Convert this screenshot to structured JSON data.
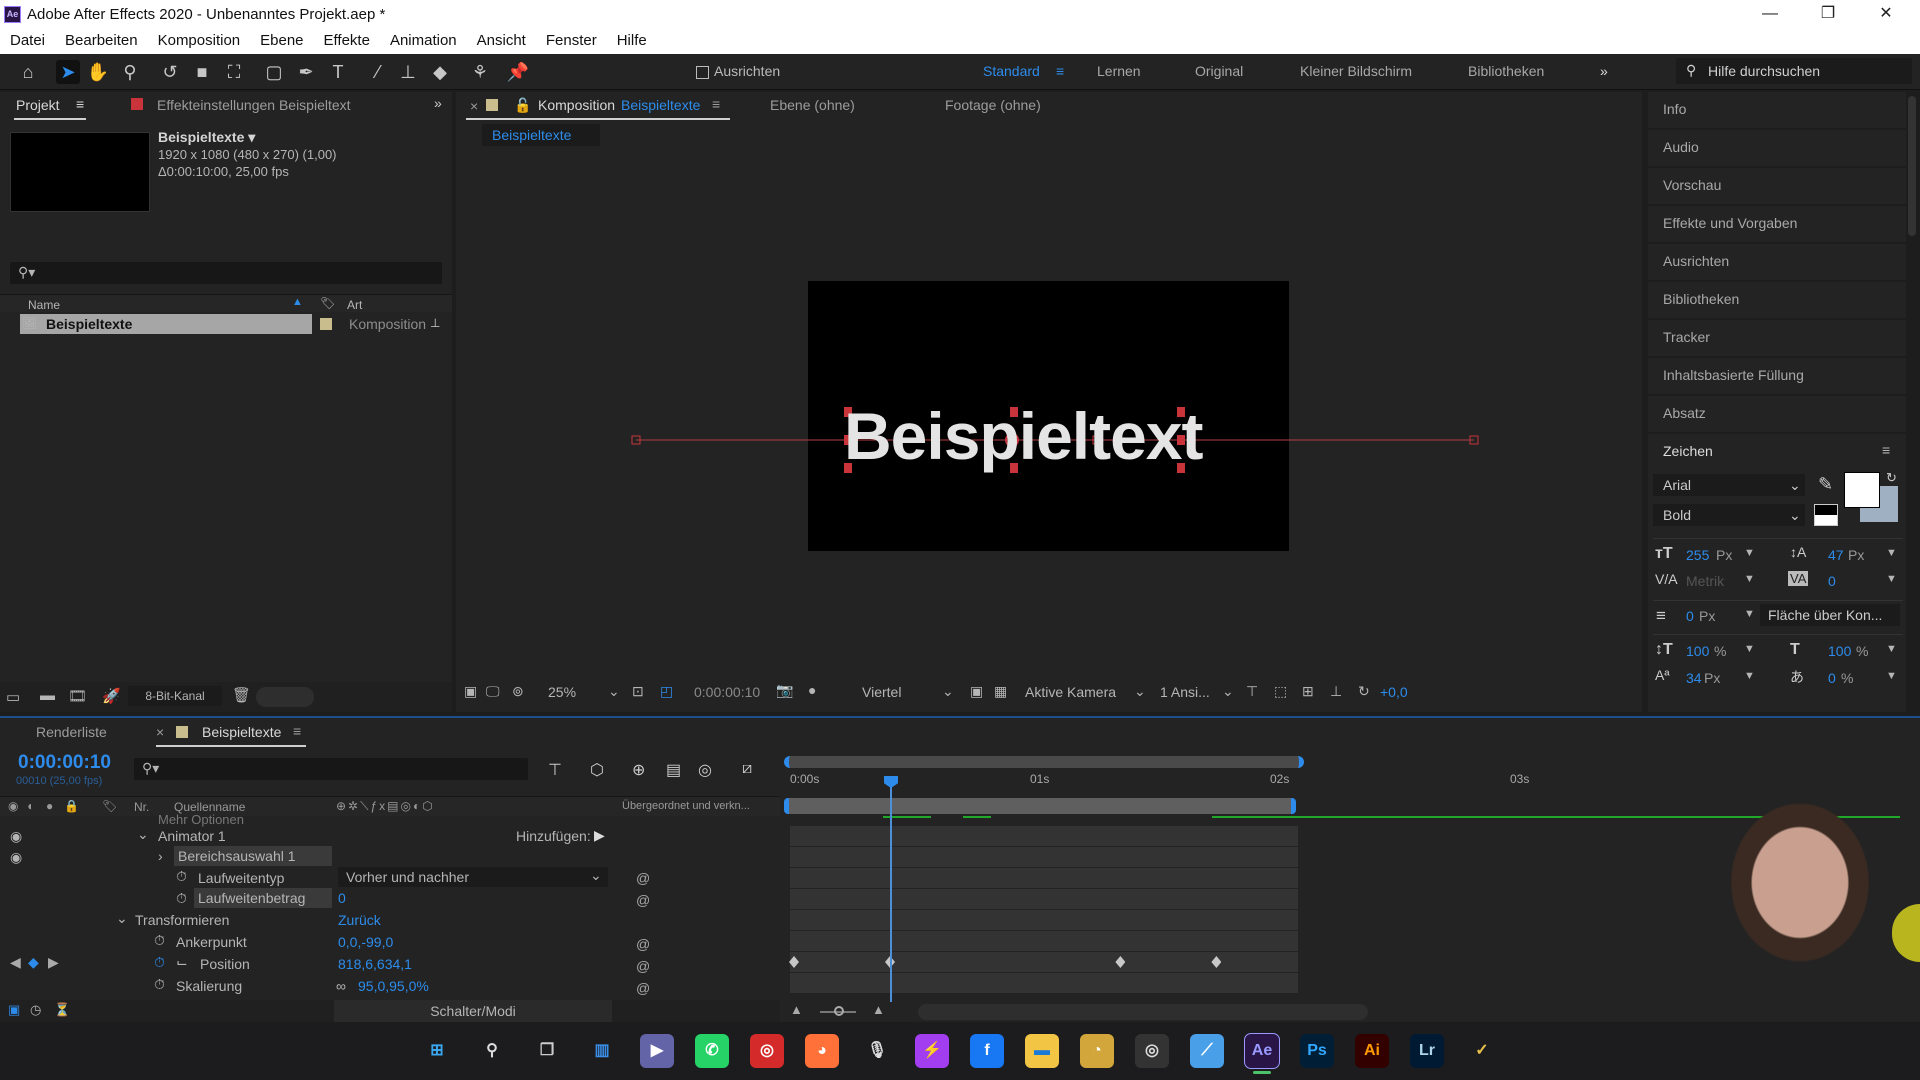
{
  "app": {
    "title": "Adobe After Effects 2020 - Unbenanntes Projekt.aep *",
    "logo": "Ae",
    "window_controls": {
      "minimize": "—",
      "restore": "❐",
      "close": "✕"
    }
  },
  "menu": [
    "Datei",
    "Bearbeiten",
    "Komposition",
    "Ebene",
    "Effekte",
    "Animation",
    "Ansicht",
    "Fenster",
    "Hilfe"
  ],
  "toolbar": {
    "tools": [
      "home-icon",
      "selection-tool-icon",
      "hand-tool-icon",
      "zoom-tool-icon",
      "rotate-tool-icon",
      "camera-tool-icon",
      "pan-behind-tool-icon",
      "rectangle-tool-icon",
      "pen-tool-icon",
      "type-tool-icon",
      "brush-tool-icon",
      "clone-stamp-tool-icon",
      "eraser-tool-icon",
      "roto-brush-tool-icon",
      "puppet-pin-tool-icon"
    ],
    "snap_label": "Ausrichten",
    "workspaces": [
      {
        "label": "Standard",
        "active": true
      },
      {
        "label": "Lernen",
        "active": false
      },
      {
        "label": "Original",
        "active": false
      },
      {
        "label": "Kleiner Bildschirm",
        "active": false
      },
      {
        "label": "Bibliotheken",
        "active": false
      }
    ],
    "more": "»",
    "help_placeholder": "Hilfe durchsuchen"
  },
  "project_panel": {
    "tab_label": "Projekt",
    "effects_tab_label": "Effekteinstellungen Beispieltext",
    "selected_item": {
      "name": "Beispieltexte ▾",
      "resolution": "1920 x 1080 (480 x 270) (1,00)",
      "duration": "Δ0:00:10:00, 25,00 fps"
    },
    "columns": {
      "name": "Name",
      "type": "Art"
    },
    "items": [
      {
        "name": "Beispieltexte",
        "type": "Komposition"
      }
    ],
    "bit_depth": "8-Bit-Kanal"
  },
  "comp_panel": {
    "tab_prefix": "Komposition",
    "tab_name": "Beispieltexte",
    "layer_tab": "Ebene (ohne)",
    "footage_tab": "Footage (ohne)",
    "breadcrumb": "Beispieltexte",
    "canvas_text": "Beispieltext",
    "footer": {
      "zoom": "25%",
      "timecode": "0:00:00:10",
      "resolution": "Viertel",
      "camera": "Aktive Kamera",
      "views": "1 Ansi...",
      "exposure": "+0,0"
    }
  },
  "right_panels": [
    "Info",
    "Audio",
    "Vorschau",
    "Effekte und Vorgaben",
    "Ausrichten",
    "Bibliotheken",
    "Tracker",
    "Inhaltsbasierte Füllung",
    "Absatz"
  ],
  "character_panel": {
    "title": "Zeichen",
    "font": "Arial",
    "style": "Bold",
    "font_size": "255",
    "leading": "47",
    "kerning": "Metrik",
    "tracking": "0",
    "stroke_width": "0",
    "stroke_mode": "Fläche über Kon...",
    "vertical_scale": "100",
    "horizontal_scale": "100",
    "baseline_shift": "34",
    "tsume": "0",
    "unit_px": "Px",
    "unit_pct": "%",
    "fill_color": "#ffffff"
  },
  "timeline": {
    "render_tab": "Renderliste",
    "comp_tab": "Beispieltexte",
    "timecode": "0:00:00:10",
    "frame_info": "00010 (25,00 fps)",
    "col_nr": "Nr.",
    "col_source": "Quellenname",
    "col_parent": "Übergeordnet und verkn...",
    "ruler": [
      "0:00s",
      "01s",
      "02s",
      "03s"
    ],
    "switches_label": "Schalter/Modi",
    "partial_row": "Mehr Optionen",
    "rows": [
      {
        "label": "Animator 1",
        "value": "",
        "extra": "Hinzufügen:"
      },
      {
        "label": "Bereichsauswahl 1",
        "value": ""
      },
      {
        "label": "Laufweitentyp",
        "value": "Vorher und nachher"
      },
      {
        "label": "Laufweitenbetrag",
        "value": "0"
      },
      {
        "label": "Transformieren",
        "value": "Zurück"
      },
      {
        "label": "Ankerpunkt",
        "value": "0,0,-99,0"
      },
      {
        "label": "Position",
        "value": "818,6,634,1"
      },
      {
        "label": "Skalierung",
        "value": "95,0,95,0%"
      }
    ],
    "current_time_seconds": 0.4,
    "work_area_end_seconds": 2.1,
    "position_keyframes_seconds": [
      0.0,
      0.4,
      1.36,
      1.76
    ]
  },
  "taskbar": [
    "windows-start",
    "search",
    "task-view",
    "widgets",
    "teams",
    "whatsapp",
    "app-red",
    "firefox",
    "podcast-mic",
    "messenger",
    "facebook",
    "file-explorer",
    "app-yellow",
    "obs",
    "app-vs",
    "Ae",
    "Ps",
    "Ai",
    "Lr",
    "app-misc"
  ]
}
